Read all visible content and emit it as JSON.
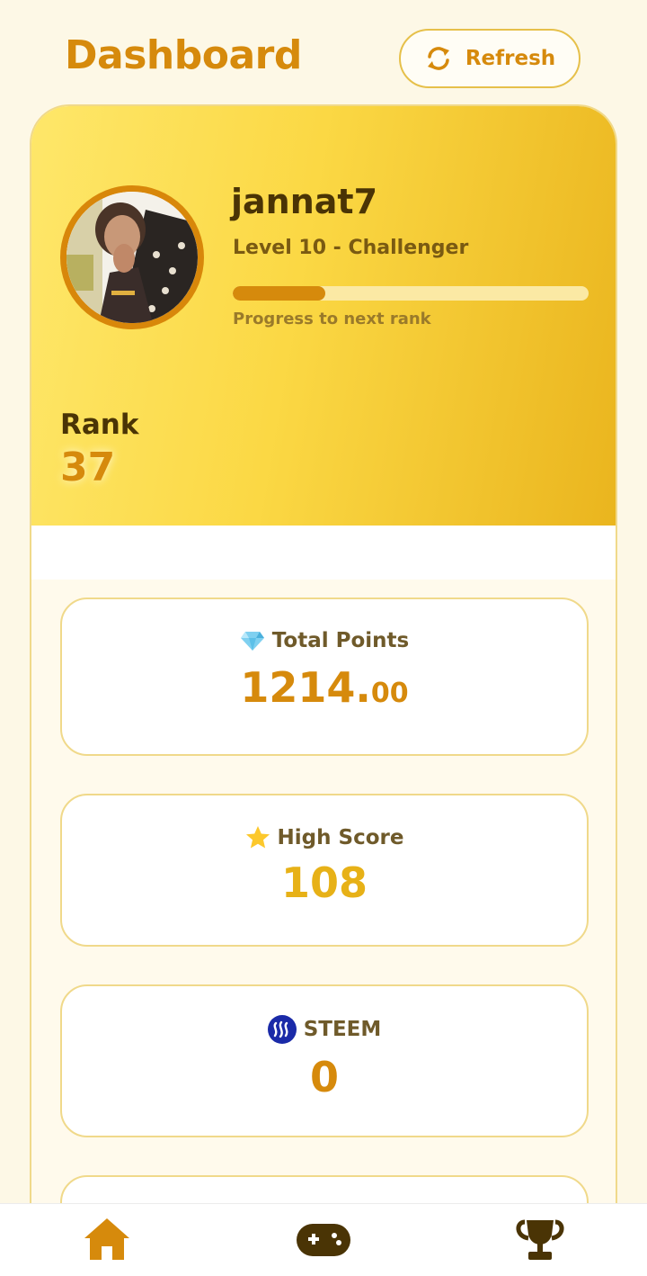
{
  "header": {
    "title": "Dashboard",
    "refresh_label": "Refresh"
  },
  "profile": {
    "username": "jannat7",
    "level": "Level 10 - Challenger",
    "progress_fraction": 0.26,
    "progress_label": "Progress to next rank",
    "rank_label": "Rank",
    "rank_value": "37"
  },
  "stats": [
    {
      "icon": "gem-icon",
      "label": "Total Points",
      "value_main": "1214.",
      "value_decimal": "00"
    },
    {
      "icon": "star-icon",
      "label": "High Score",
      "value": "108"
    },
    {
      "icon": "steem-icon",
      "label": "STEEM",
      "value": "0"
    }
  ],
  "nav": {
    "items": [
      {
        "icon": "home-icon",
        "active": true
      },
      {
        "icon": "gamepad-icon",
        "active": false
      },
      {
        "icon": "trophy-icon",
        "active": false
      }
    ]
  },
  "colors": {
    "accent": "#d68a0c",
    "gold": "#e7b117",
    "background": "#fdf8e6",
    "dark_text": "#4a3405",
    "steem_blue": "#1a2aa8"
  }
}
